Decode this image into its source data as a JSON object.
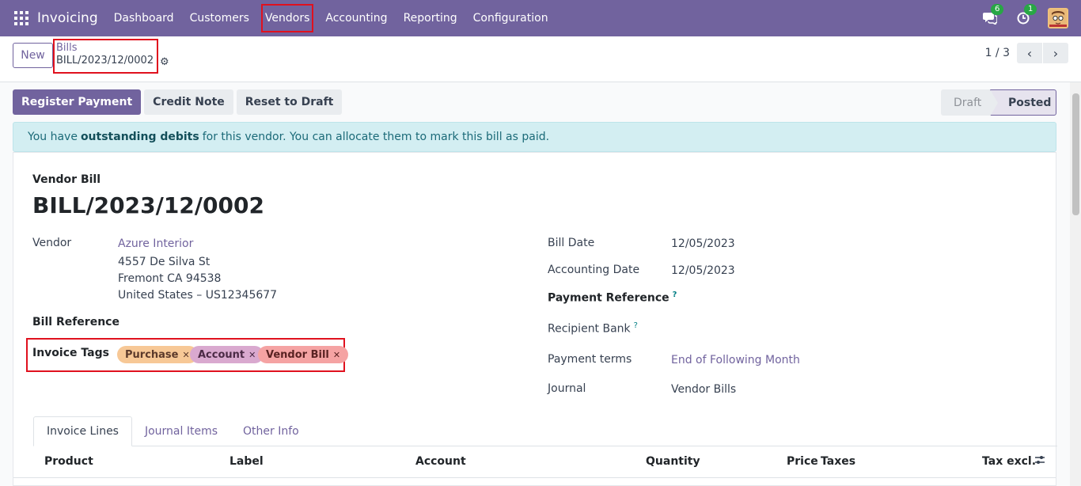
{
  "navbar": {
    "app_name": "Invoicing",
    "menu": [
      "Dashboard",
      "Customers",
      "Vendors",
      "Accounting",
      "Reporting",
      "Configuration"
    ],
    "chat_count": "6",
    "activity_count": "1"
  },
  "control_panel": {
    "new_label": "New",
    "breadcrumb_parent": "Bills",
    "breadcrumb_current": "BILL/2023/12/0002",
    "pager": "1 / 3"
  },
  "actions": {
    "register_payment": "Register Payment",
    "credit_note": "Credit Note",
    "reset_to_draft": "Reset to Draft"
  },
  "status": {
    "draft": "Draft",
    "posted": "Posted"
  },
  "alert": {
    "before": "You have",
    "bold": "outstanding debits",
    "after": "for this vendor. You can allocate them to mark this bill as paid."
  },
  "sheet": {
    "doc_type": "Vendor Bill",
    "doc_name": "BILL/2023/12/0002",
    "vendor_label": "Vendor",
    "vendor_name": "Azure Interior",
    "vendor_street": "4557 De Silva St",
    "vendor_city": "Fremont CA 94538",
    "vendor_country": "United States – US12345677",
    "bill_reference_label": "Bill Reference",
    "invoice_tags_label": "Invoice Tags",
    "tags": [
      "Purchase",
      "Account",
      "Vendor Bill"
    ],
    "bill_date_label": "Bill Date",
    "bill_date": "12/05/2023",
    "accounting_date_label": "Accounting Date",
    "accounting_date": "12/05/2023",
    "payment_reference_label": "Payment Reference",
    "recipient_bank_label": "Recipient Bank",
    "payment_terms_label": "Payment terms",
    "payment_terms": "End of Following Month",
    "journal_label": "Journal",
    "journal": "Vendor Bills"
  },
  "tabs": [
    "Invoice Lines",
    "Journal Items",
    "Other Info"
  ],
  "table_columns": [
    "Product",
    "Label",
    "Account",
    "Quantity",
    "Price",
    "Taxes",
    "Tax excl."
  ],
  "colors": {
    "brand": "#71639e",
    "highlight": "#e0111e",
    "tag_purchase": "#f7c896",
    "tag_account": "#d9a9cf",
    "tag_vendor_bill": "#f5a3a3"
  }
}
